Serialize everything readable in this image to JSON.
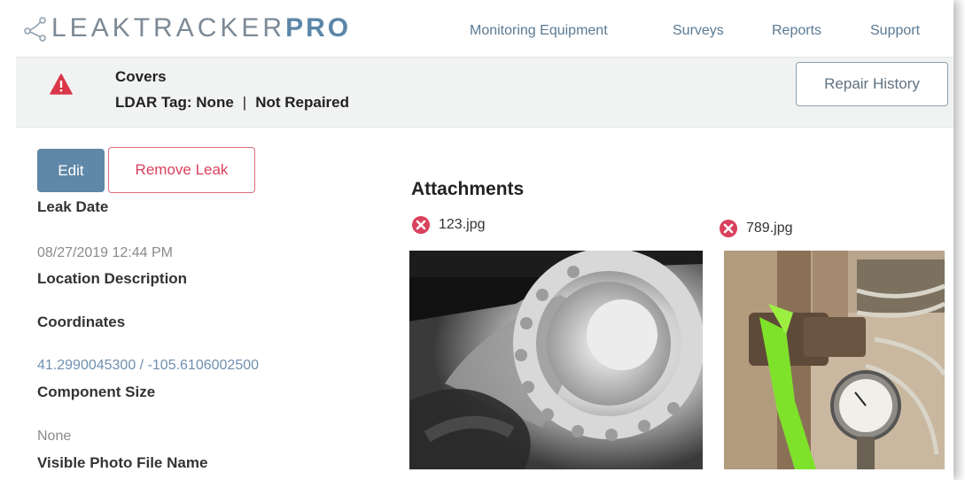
{
  "brand": {
    "name_light": "LEAKTRACKER",
    "name_bold": "PRO"
  },
  "nav": {
    "items": [
      {
        "label": "Monitoring Equipment"
      },
      {
        "label": "Surveys"
      },
      {
        "label": "Reports"
      },
      {
        "label": "Support"
      }
    ]
  },
  "alert": {
    "icon": "warning-triangle-icon",
    "title": "Covers",
    "ldar_tag": "LDAR Tag: None",
    "separator": "|",
    "status": "Not Repaired",
    "repair_history_label": "Repair History"
  },
  "actions": {
    "edit_label": "Edit",
    "remove_label": "Remove Leak"
  },
  "fields": {
    "leak_date_label": "Leak Date",
    "leak_date_value": "08/27/2019 12:44 PM",
    "location_label": "Location Description",
    "coordinates_label": "Coordinates",
    "coordinates_value": "41.2990045300 / -105.6106002500",
    "component_size_label": "Component Size",
    "component_size_value": "None",
    "visible_photo_label": "Visible Photo File Name"
  },
  "attachments": {
    "title": "Attachments",
    "items": [
      {
        "name": "123.jpg"
      },
      {
        "name": "789.jpg"
      }
    ]
  },
  "colors": {
    "accent": "#5f87a7",
    "danger": "#d9415c",
    "warning_icon": "#d9364a",
    "link": "#6f8fb0"
  }
}
